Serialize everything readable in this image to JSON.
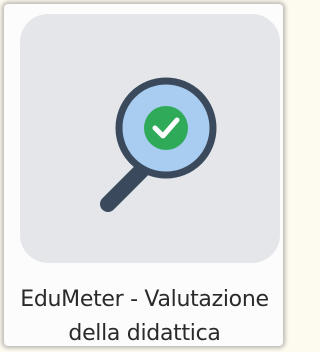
{
  "app": {
    "name_line1": "EduMeter - Valutazione",
    "name_line2": "della didattica",
    "icon": "magnifier-checkmark-icon"
  },
  "colors": {
    "icon_background": "#e4e6ea",
    "lens_ring": "#3a4a5c",
    "lens_fill": "#a9cdf0",
    "check_circle": "#2eaa58",
    "check_mark": "#ffffff",
    "label_text": "#2a2a2a"
  }
}
